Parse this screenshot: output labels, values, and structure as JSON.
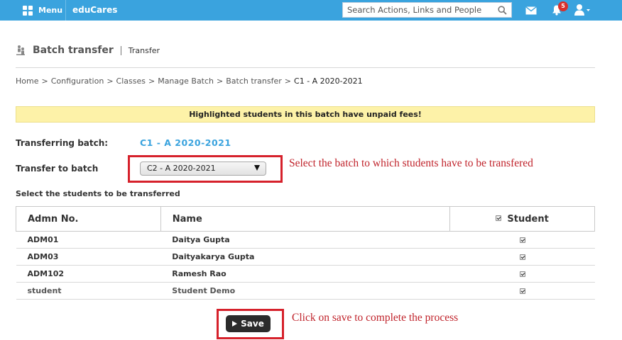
{
  "topbar": {
    "menu_label": "Menu",
    "brand": "eduCares",
    "search_placeholder": "Search Actions, Links and People",
    "notification_count": "5",
    "colors": {
      "bar": "#3aa3de",
      "badge": "#d9302b"
    },
    "icons": [
      "menu-grid-icon",
      "search-icon",
      "mail-icon",
      "bell-icon",
      "user-icon",
      "caret-down-icon"
    ]
  },
  "header": {
    "title": "Batch transfer",
    "subtitle": "Transfer",
    "icon": "batch-transfer-icon"
  },
  "breadcrumb": {
    "items": [
      "Home",
      "Configuration",
      "Classes",
      "Manage Batch",
      "Batch transfer"
    ],
    "current": "C1 - A 2020-2021",
    "separator": ">"
  },
  "alert": {
    "text": "Highlighted students in this batch have unpaid fees!",
    "color": "#fdf2a8"
  },
  "form": {
    "transferring_label": "Transferring batch:",
    "transferring_value": "C1 - A 2020-2021",
    "transfer_to_label": "Transfer to batch",
    "transfer_to_selected": "C2 - A 2020-2021",
    "students_label": "Select the students to be transferred"
  },
  "annotations": {
    "select_hint": "Select the batch to which students have to be transfered",
    "save_hint": "Click on save to complete the process",
    "color": "#c0232b"
  },
  "table": {
    "headers": {
      "admn": "Admn No.",
      "name": "Name",
      "student": "Student"
    },
    "rows": [
      {
        "admn": "ADM01",
        "name": "Daitya Gupta",
        "checked": true
      },
      {
        "admn": "ADM03",
        "name": "Daityakarya Gupta",
        "checked": true
      },
      {
        "admn": "ADM102",
        "name": "Ramesh Rao",
        "checked": true
      },
      {
        "admn": "student",
        "name": "Student Demo",
        "checked": true
      }
    ]
  },
  "actions": {
    "save_label": "Save"
  }
}
